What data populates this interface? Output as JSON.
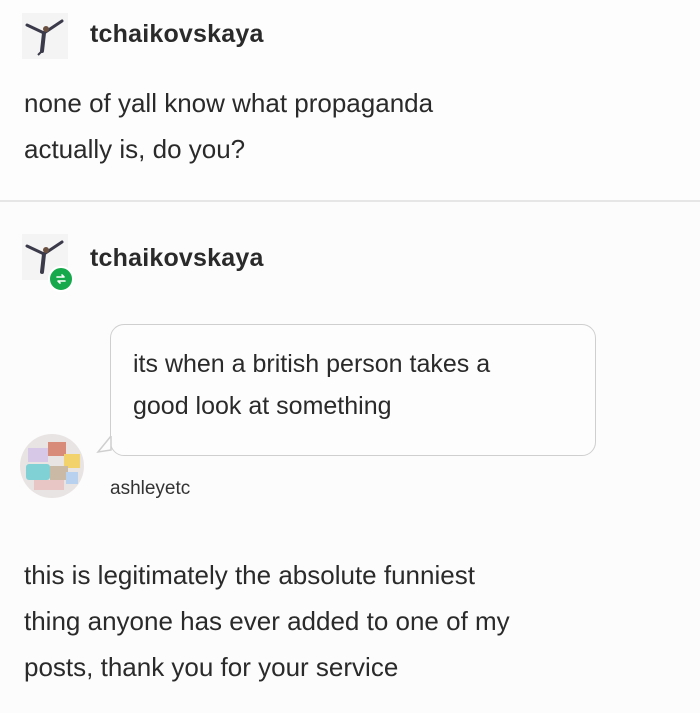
{
  "post": {
    "username": "tchaikovskaya",
    "body_lines": [
      "none of yall know what propaganda",
      "actually is, do you?"
    ]
  },
  "reblog": {
    "username": "tchaikovskaya",
    "badge_icon": "reblog-icon",
    "badge_color": "#15a94b",
    "answer": {
      "lines": [
        "its when a british person takes a",
        "good look at something"
      ],
      "asker": "ashleyetc"
    },
    "body_lines": [
      "this is legitimately the absolute funniest",
      "thing anyone has ever added to one of my",
      "posts, thank you for your service"
    ]
  }
}
